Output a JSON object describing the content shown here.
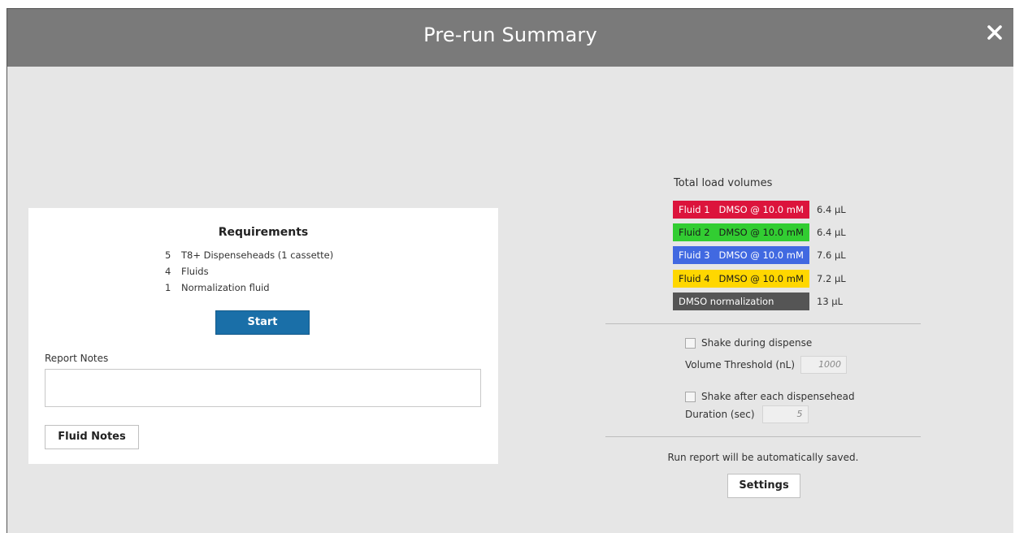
{
  "dialog": {
    "title": "Pre-run Summary"
  },
  "requirements": {
    "title": "Requirements",
    "items": [
      {
        "count": "5",
        "label": "T8+ Dispenseheads (1 cassette)"
      },
      {
        "count": "4",
        "label": "Fluids"
      },
      {
        "count": "1",
        "label": "Normalization fluid"
      }
    ],
    "start_label": "Start",
    "report_notes_label": "Report Notes",
    "report_notes_value": "",
    "fluid_notes_label": "Fluid Notes"
  },
  "load_volumes": {
    "title": "Total load volumes",
    "fluids": [
      {
        "name": "Fluid 1",
        "desc": "DMSO @ 10.0 mM",
        "volume": "6.4 µL",
        "color": "#dc143c",
        "text_color": "#ffffff"
      },
      {
        "name": "Fluid 2",
        "desc": "DMSO @ 10.0 mM",
        "volume": "6.4 µL",
        "color": "#32cd32",
        "text_color": "#1a1a1a"
      },
      {
        "name": "Fluid 3",
        "desc": "DMSO @ 10.0 mM",
        "volume": "7.6 µL",
        "color": "#4169e1",
        "text_color": "#ffffff"
      },
      {
        "name": "Fluid 4",
        "desc": "DMSO @ 10.0 mM",
        "volume": "7.2 µL",
        "color": "#ffd700",
        "text_color": "#1a1a1a"
      }
    ],
    "normalization": {
      "label": "DMSO normalization",
      "volume": "13 µL",
      "color": "#555555",
      "text_color": "#ffffff"
    }
  },
  "shake": {
    "during_label": "Shake during dispense",
    "threshold_label": "Volume Threshold (nL)",
    "threshold_value": "1000",
    "after_label": "Shake after each dispensehead",
    "duration_label": "Duration (sec)",
    "duration_value": "5"
  },
  "footer": {
    "saved_text": "Run report will be automatically saved.",
    "settings_label": "Settings"
  }
}
